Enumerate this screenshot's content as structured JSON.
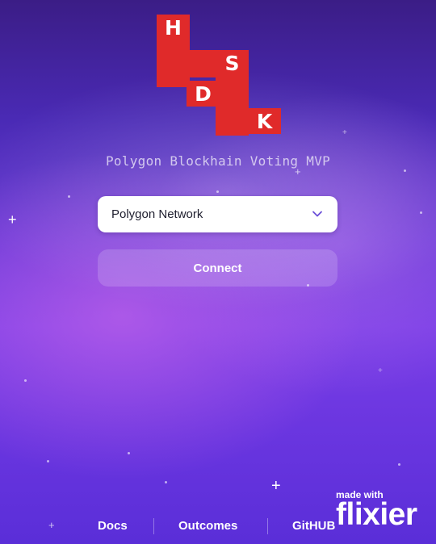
{
  "logo": {
    "letters": [
      "H",
      "S",
      "D",
      "K"
    ]
  },
  "subtitle": "Polygon Blockhain Voting MVP",
  "network_select": {
    "selected": "Polygon Network",
    "icon": "chevron-down-icon"
  },
  "connect_label": "Connect",
  "footer": {
    "links": [
      "Docs",
      "Outcomes",
      "GitHUB"
    ]
  },
  "watermark": {
    "made_with": "made with",
    "brand": "flixier"
  },
  "colors": {
    "logo_red": "#e02a2a",
    "background_top": "#3b1d86",
    "background_bottom": "#5a2ed8",
    "chevron": "#6b4fd8"
  }
}
